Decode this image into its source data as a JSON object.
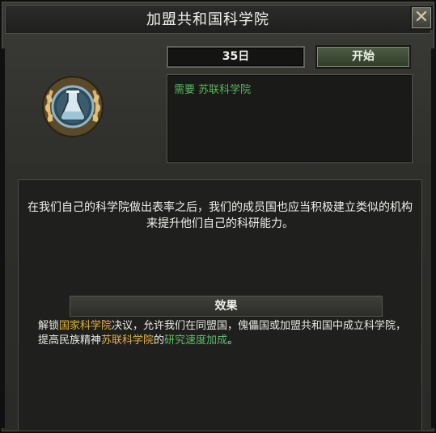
{
  "window": {
    "title": "加盟共和国科学院",
    "close_icon": "close-x-icon"
  },
  "decision": {
    "days": "35日",
    "start_label": "开始",
    "requirement_prefix": "需要 ",
    "requirement_name": "苏联科学院",
    "emblem_icon": "science-flask-laurel-icon"
  },
  "body": {
    "description": "在我们自己的科学院做出表率之后，我们的成员国也应当积极建立类似的机构来提升他们自己的科研能力。",
    "effect_header": "效果",
    "effect": {
      "p1": "解锁",
      "h1": "国家科学院",
      "p2": "决议，允许我们在同盟国，傀儡国或加盟共和国中成立科学院，提高民族精神",
      "h2": "苏联科学院",
      "p3": "的",
      "h3": "研究速度加成",
      "p4": "。"
    }
  },
  "colors": {
    "requirement_green": "#5bb85c",
    "highlight_yellow": "#e4b43a",
    "highlight_green": "#5fbf6a"
  }
}
